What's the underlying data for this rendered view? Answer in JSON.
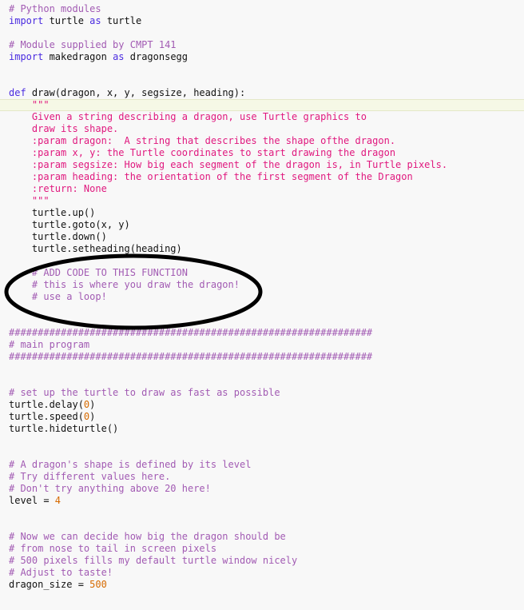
{
  "colors": {
    "comment": "#a25bb3",
    "docstring": "#e0187e",
    "keyword": "#4a2be0",
    "number": "#d66a00",
    "text": "#111111",
    "background": "#f8f8f8",
    "annotation": "#000000"
  },
  "current_line": 8,
  "annotation": {
    "shape": "ellipse",
    "color": "#000000",
    "encloses": "# ADD CODE TO THIS FUNCTION comment block"
  },
  "lines": [
    [
      [
        "cm",
        "# Python modules"
      ]
    ],
    [
      [
        "kw",
        "import"
      ],
      [
        "tx",
        " turtle "
      ],
      [
        "kw",
        "as"
      ],
      [
        "tx",
        " turtle"
      ]
    ],
    [],
    [
      [
        "cm",
        "# Module supplied by CMPT 141"
      ]
    ],
    [
      [
        "kw",
        "import"
      ],
      [
        "tx",
        " makedragon "
      ],
      [
        "kw",
        "as"
      ],
      [
        "tx",
        " dragonsegg"
      ]
    ],
    [],
    [],
    [
      [
        "kw",
        "def"
      ],
      [
        "tx",
        " draw(dragon, x, y, segsize, heading):"
      ]
    ],
    [
      [
        "doc",
        "    \"\"\""
      ]
    ],
    [
      [
        "doc",
        "    Given a string describing a dragon, use Turtle graphics to"
      ]
    ],
    [
      [
        "doc",
        "    draw its shape."
      ]
    ],
    [
      [
        "doc",
        "    :param dragon:  A string that describes the shape ofthe dragon."
      ]
    ],
    [
      [
        "doc",
        "    :param x, y: the Turtle coordinates to start drawing the dragon"
      ]
    ],
    [
      [
        "doc",
        "    :param segsize: How big each segment of the dragon is, in Turtle pixels."
      ]
    ],
    [
      [
        "doc",
        "    :param heading: the orientation of the first segment of the Dragon"
      ]
    ],
    [
      [
        "doc",
        "    :return: None"
      ]
    ],
    [
      [
        "doc",
        "    \"\"\""
      ]
    ],
    [
      [
        "tx",
        "    turtle.up()"
      ]
    ],
    [
      [
        "tx",
        "    turtle.goto(x, y)"
      ]
    ],
    [
      [
        "tx",
        "    turtle.down()"
      ]
    ],
    [
      [
        "tx",
        "    turtle.setheading(heading)"
      ]
    ],
    [],
    [
      [
        "cm",
        "    # ADD CODE TO THIS FUNCTION"
      ]
    ],
    [
      [
        "cm",
        "    # this is where you draw the dragon!"
      ]
    ],
    [
      [
        "cm",
        "    # use a loop!"
      ]
    ],
    [],
    [],
    [
      [
        "cm",
        "###############################################################"
      ]
    ],
    [
      [
        "cm",
        "# main program"
      ]
    ],
    [
      [
        "cm",
        "###############################################################"
      ]
    ],
    [],
    [],
    [
      [
        "cm",
        "# set up the turtle to draw as fast as possible"
      ]
    ],
    [
      [
        "tx",
        "turtle.delay("
      ],
      [
        "num",
        "0"
      ],
      [
        "tx",
        ")"
      ]
    ],
    [
      [
        "tx",
        "turtle.speed("
      ],
      [
        "num",
        "0"
      ],
      [
        "tx",
        ")"
      ]
    ],
    [
      [
        "tx",
        "turtle.hideturtle()"
      ]
    ],
    [],
    [],
    [
      [
        "cm",
        "# A dragon's shape is defined by its level"
      ]
    ],
    [
      [
        "cm",
        "# Try different values here."
      ]
    ],
    [
      [
        "cm",
        "# Don't try anything above 20 here!"
      ]
    ],
    [
      [
        "tx",
        "level = "
      ],
      [
        "num",
        "4"
      ]
    ],
    [],
    [],
    [
      [
        "cm",
        "# Now we can decide how big the dragon should be"
      ]
    ],
    [
      [
        "cm",
        "# from nose to tail in screen pixels"
      ]
    ],
    [
      [
        "cm",
        "# 500 pixels fills my default turtle window nicely"
      ]
    ],
    [
      [
        "cm",
        "# Adjust to taste!"
      ]
    ],
    [
      [
        "tx",
        "dragon_size = "
      ],
      [
        "num",
        "500"
      ]
    ]
  ]
}
